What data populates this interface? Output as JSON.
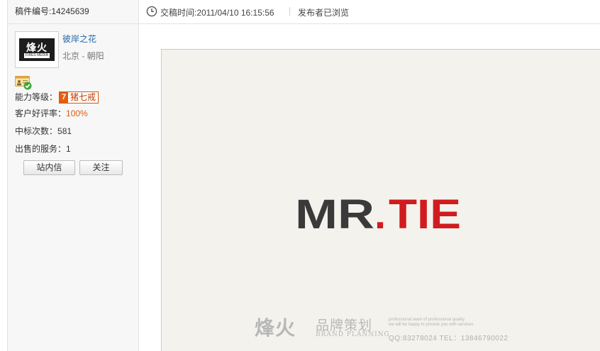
{
  "entry": {
    "label": "稿件编号",
    "id": "14245639",
    "full": "稿件编号:14245639"
  },
  "designer": {
    "avatar_text": "烽火",
    "avatar_subtext": "FIRES MEDIA",
    "name": "彼岸之花",
    "location": "北京 - 朝阳",
    "stats": {
      "level_label": "能力等级：",
      "level_num": "7",
      "level_name": "猪七戒",
      "rating_label": "客户好评率：",
      "rating_value": "100%",
      "wins_label": "中标次数：",
      "wins_value": "581",
      "services_label": "出售的服务：",
      "services_value": "1"
    },
    "buttons": {
      "message": "站内信",
      "follow": "关注"
    }
  },
  "topbar": {
    "submit_time": "交稿时间:2011/04/10 16:15:56",
    "viewed": "发布者已浏览"
  },
  "artwork": {
    "logo": {
      "left": "MR",
      "dot": ".",
      "right": "TIE",
      "dark_color": "#3a3a3a",
      "accent_color": "#d01c1f"
    },
    "brand_cn": "烽火",
    "planning_cn": "品牌策划",
    "planning_en": "BRAND PLANNING",
    "tagline1": "professional team of professional quality",
    "tagline2": "we will be happy to provide you with services",
    "contact": "QQ:83278024  TEL：13846790022"
  }
}
